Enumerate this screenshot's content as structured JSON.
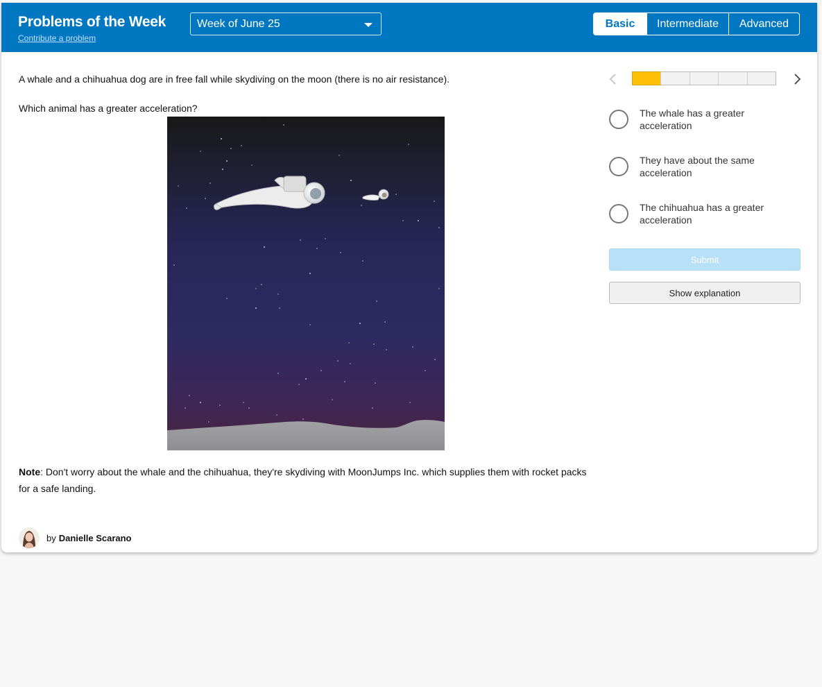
{
  "header": {
    "title": "Problems of the Week",
    "contribute_link": "Contribute a problem",
    "week_select": {
      "value": "Week of June 25"
    },
    "levels": [
      "Basic",
      "Intermediate",
      "Advanced"
    ],
    "active_level": "Basic",
    "brand_color": "#0077c0"
  },
  "problem": {
    "question": "A whale and a chihuahua dog are in free fall while skydiving on the moon (there is no air resistance).",
    "prompt": "Which animal has a greater acceleration?",
    "note_label": "Note",
    "note_text": ": Don't worry about the whale and the chihuahua, they're skydiving with MoonJumps Inc. which supplies them with rocket packs for a safe landing.",
    "author_prefix": "by",
    "author_name": "Danielle Scarano"
  },
  "answer_panel": {
    "progress": {
      "completed": 1,
      "total": 5,
      "color": "#ffc107"
    },
    "choices": [
      "The whale has a greater acceleration",
      "They have about the same acceleration",
      "The chihuahua has a greater acceleration"
    ],
    "submit_label": "Submit",
    "explanation_label": "Show explanation"
  }
}
